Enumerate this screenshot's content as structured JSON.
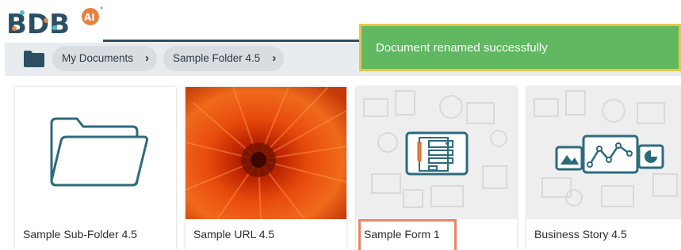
{
  "app": {
    "logo_text": "BDB",
    "logo_badge": "AI"
  },
  "breadcrumb": {
    "items": [
      {
        "label": "My Documents"
      },
      {
        "label": "Sample Folder 4.5"
      }
    ]
  },
  "toast": {
    "message": "Document renamed successfully"
  },
  "cards": [
    {
      "title": "Sample Sub-Folder 4.5",
      "kind": "folder-icon"
    },
    {
      "title": "Sample URL 4.5",
      "kind": "flower-image"
    },
    {
      "title": "Sample Form 1",
      "kind": "form-icon"
    },
    {
      "title": "Business Story 4.5",
      "kind": "story-icon"
    }
  ],
  "colors": {
    "accent": "#2c4f64",
    "toast_bg": "#60b860",
    "toast_border": "#e9c54a",
    "highlight": "#e8866a"
  }
}
